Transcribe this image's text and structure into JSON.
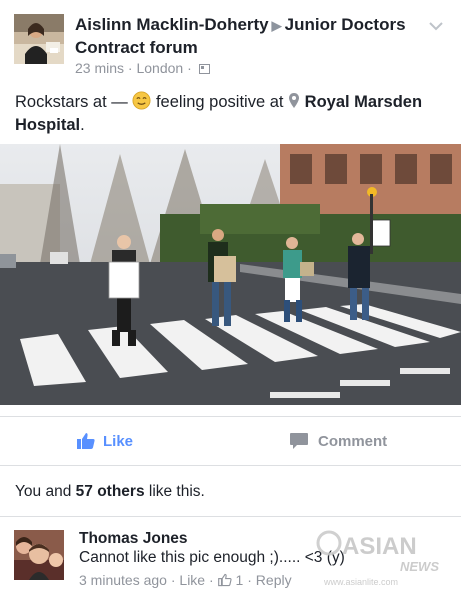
{
  "post": {
    "author": "Aislinn Macklin-Doherty",
    "group": "Junior Doctors Contract forum",
    "time": "23 mins",
    "location": "London",
    "status_prefix": "Rockstars at — ",
    "feeling": "feeling positive at",
    "place": "Royal Marsden Hospital",
    "place_end": "."
  },
  "actions": {
    "like_label": "Like",
    "comment_label": "Comment"
  },
  "likes": {
    "prefix": "You and ",
    "count": "57 others",
    "suffix": " like this."
  },
  "comment": {
    "author": "Thomas Jones",
    "text": "Cannot like this pic enough ;)..... <3 (y)",
    "time": "3 minutes ago",
    "like_link": "Like",
    "like_count": "1",
    "reply_link": "Reply"
  },
  "watermark": {
    "brand": "ASIAN",
    "sub": "NEWS",
    "url": "www.asianlite.com"
  },
  "colors": {
    "like_blue": "#5890ff",
    "meta_gray": "#90949c",
    "text": "#1d2129"
  }
}
